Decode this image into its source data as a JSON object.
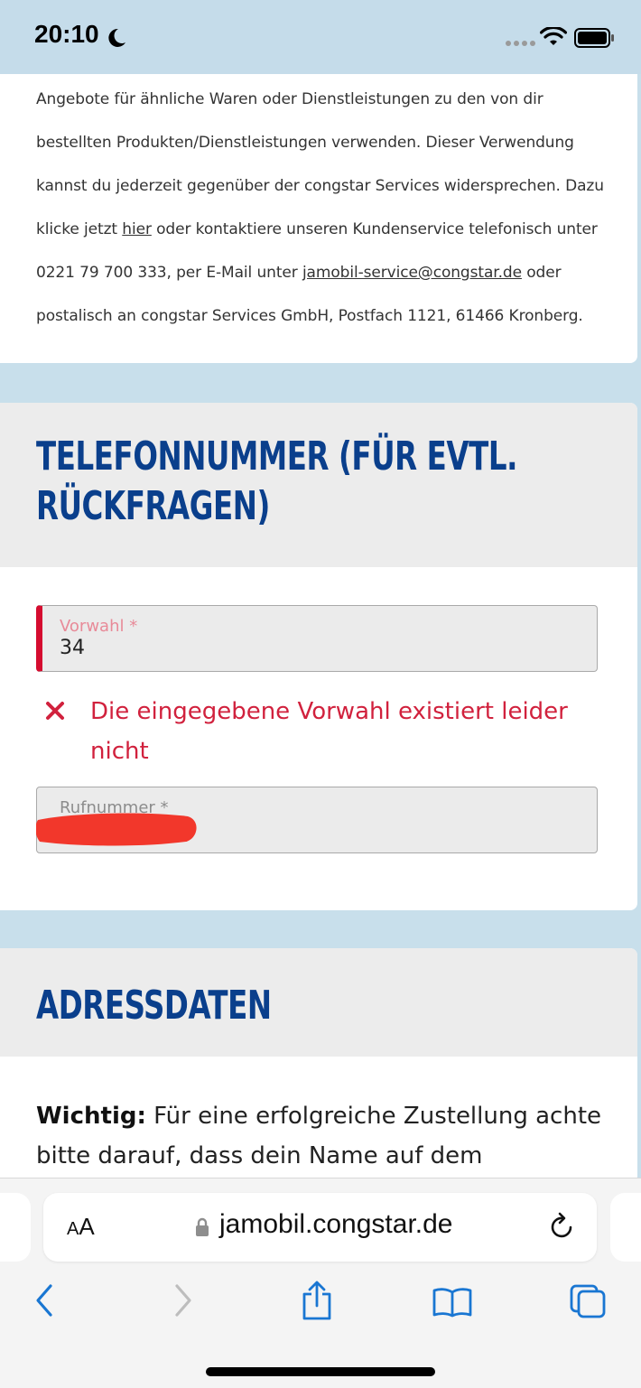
{
  "status_bar": {
    "time": "20:10"
  },
  "consent": {
    "text_1": "Angebote für ähnliche Waren oder Dienstleistungen zu den von dir bestellten Produkten/Dienstleistungen verwenden. Dieser Verwendung kannst du jederzeit gegenüber der congstar Services widersprechen. Dazu klicke jetzt ",
    "link_here": "hier",
    "text_2": " oder kontaktiere unseren Kundenservice telefonisch unter 0221 79 700 333, per E-Mail unter ",
    "email_link": "jamobil-service@congstar.de",
    "text_3": " oder postalisch an congstar Services GmbH, Postfach 1121, 61466 Kronberg."
  },
  "phone_section": {
    "title": "TELEFONNUMMER (FÜR EVTL. RÜCKFRAGEN)",
    "area_code_label": "Vorwahl *",
    "area_code_value": "34",
    "error_message": "Die eingegebene Vorwahl existiert leider nicht",
    "number_label": "Rufnummer *"
  },
  "address_section": {
    "title": "ADRESSDATEN",
    "important_label": "Wichtig:",
    "important_text": " Für eine erfolgreiche Zustellung achte bitte darauf, dass dein Name auf dem"
  },
  "browser": {
    "text_size_small": "A",
    "text_size_large": "A",
    "domain": "jamobil.congstar.de"
  },
  "colors": {
    "brand_blue": "#0a3f8c",
    "error_red": "#d1213d",
    "page_background": "#c8dfeb"
  },
  "icons": [
    "moon-icon",
    "signal-icon",
    "wifi-icon",
    "battery-icon",
    "error-x-icon",
    "lock-icon",
    "reload-icon",
    "back-icon",
    "forward-icon",
    "share-icon",
    "bookmarks-icon",
    "tabs-icon"
  ]
}
